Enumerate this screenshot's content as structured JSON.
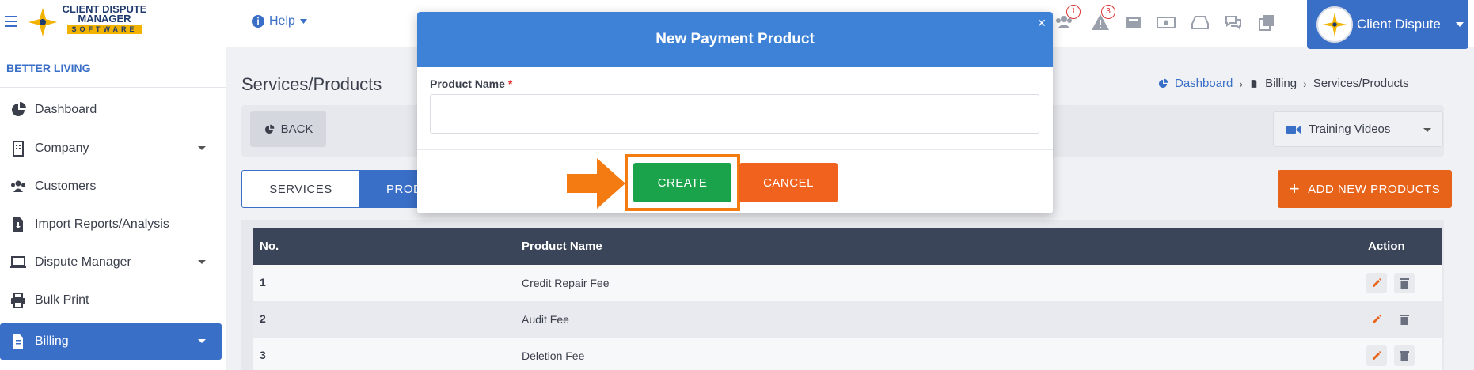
{
  "app": {
    "logo_line1": "CLIENT DISPUTE",
    "logo_line2": "MANAGER",
    "logo_line3": "SOFTWARE"
  },
  "topbar": {
    "help_label": "Help",
    "user_name": "Client Dispute",
    "badges": {
      "group_icon": "1",
      "warning_icon": "3"
    },
    "icons": [
      "menu-icon",
      "help-icon",
      "group-icon",
      "warning-icon",
      "inbox-icon",
      "money-icon",
      "tray-icon",
      "chat-icon",
      "copy-icon"
    ],
    "colors": {
      "primary": "#3a6fc8",
      "badge": "#dd3333"
    }
  },
  "sidebar": {
    "org_name": "BETTER LIVING",
    "items": [
      {
        "label": "Dashboard",
        "icon": "pie-chart-icon"
      },
      {
        "label": "Company",
        "icon": "building-icon",
        "has_caret": true
      },
      {
        "label": "Customers",
        "icon": "users-icon"
      },
      {
        "label": "Import Reports/Analysis",
        "icon": "import-file-icon"
      },
      {
        "label": "Dispute Manager",
        "icon": "laptop-icon",
        "has_caret": true
      },
      {
        "label": "Bulk Print",
        "icon": "printer-icon"
      },
      {
        "label": "Billing",
        "icon": "invoice-icon",
        "has_caret": true,
        "active": true
      }
    ]
  },
  "main": {
    "page_title": "Services/Products",
    "breadcrumb": [
      "Dashboard",
      "Billing",
      "Services/Products"
    ],
    "back_label": "BACK",
    "training_label": "Training Videos",
    "tabs": [
      "SERVICES",
      "PROD"
    ],
    "add_label": "ADD NEW PRODUCTS",
    "table": {
      "headers": [
        "No.",
        "Product Name",
        "Action"
      ],
      "rows": [
        {
          "no": "1",
          "name": "Credit Repair Fee"
        },
        {
          "no": "2",
          "name": "Audit Fee"
        },
        {
          "no": "3",
          "name": "Deletion Fee"
        }
      ]
    }
  },
  "modal": {
    "title": "New Payment Product",
    "close_glyph": "×",
    "field_label": "Product Name",
    "required_mark": "*",
    "field_value": "",
    "create_label": "CREATE",
    "cancel_label": "CANCEL",
    "colors": {
      "header": "#3d82d6",
      "create": "#1aa34a",
      "cancel": "#f0621e",
      "highlight": "#f47a12"
    }
  }
}
